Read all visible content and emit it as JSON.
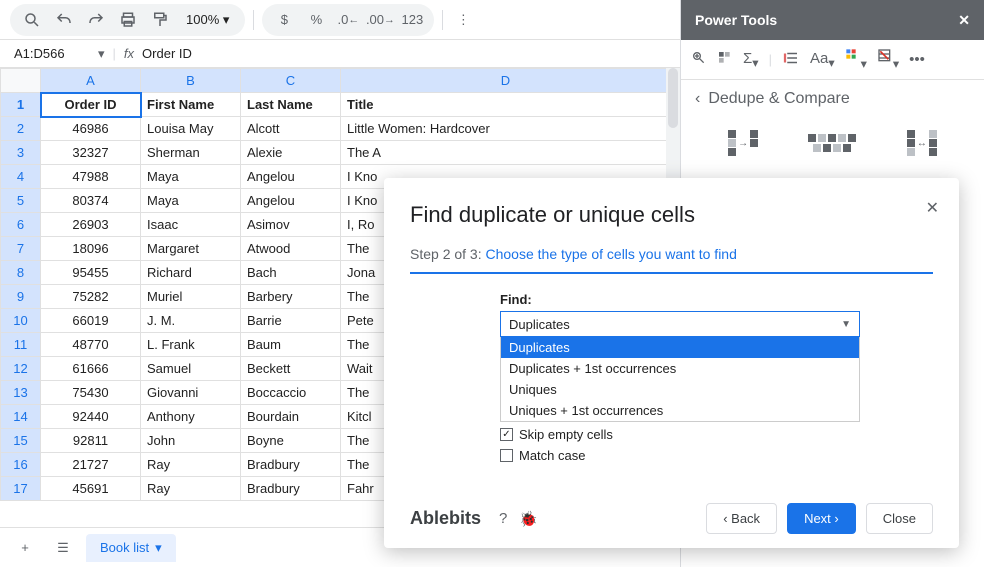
{
  "toolbar": {
    "zoom": "100%",
    "numfmt": "123"
  },
  "namebox": "A1:D566",
  "formula": "Order ID",
  "cols": [
    "A",
    "B",
    "C",
    "D"
  ],
  "headers": {
    "a": "Order ID",
    "b": "First Name",
    "c": "Last Name",
    "d": "Title"
  },
  "rows": [
    {
      "n": "2",
      "a": "46986",
      "b": "Louisa May",
      "c": "Alcott",
      "d": "Little Women: Hardcover"
    },
    {
      "n": "3",
      "a": "32327",
      "b": "Sherman",
      "c": "Alexie",
      "d": "The A"
    },
    {
      "n": "4",
      "a": "47988",
      "b": "Maya",
      "c": "Angelou",
      "d": "I Kno"
    },
    {
      "n": "5",
      "a": "80374",
      "b": "Maya",
      "c": "Angelou",
      "d": "I Kno"
    },
    {
      "n": "6",
      "a": "26903",
      "b": "Isaac",
      "c": "Asimov",
      "d": "I, Ro"
    },
    {
      "n": "7",
      "a": "18096",
      "b": "Margaret",
      "c": "Atwood",
      "d": "The"
    },
    {
      "n": "8",
      "a": "95455",
      "b": "Richard",
      "c": "Bach",
      "d": "Jona"
    },
    {
      "n": "9",
      "a": "75282",
      "b": "Muriel",
      "c": "Barbery",
      "d": "The"
    },
    {
      "n": "10",
      "a": "66019",
      "b": "J. M.",
      "c": "Barrie",
      "d": "Pete"
    },
    {
      "n": "11",
      "a": "48770",
      "b": "L. Frank",
      "c": "Baum",
      "d": "The"
    },
    {
      "n": "12",
      "a": "61666",
      "b": "Samuel",
      "c": "Beckett",
      "d": "Wait"
    },
    {
      "n": "13",
      "a": "75430",
      "b": "Giovanni",
      "c": "Boccaccio",
      "d": "The"
    },
    {
      "n": "14",
      "a": "92440",
      "b": "Anthony",
      "c": "Bourdain",
      "d": "Kitcl"
    },
    {
      "n": "15",
      "a": "92811",
      "b": "John",
      "c": "Boyne",
      "d": "The"
    },
    {
      "n": "16",
      "a": "21727",
      "b": "Ray",
      "c": "Bradbury",
      "d": "The"
    },
    {
      "n": "17",
      "a": "45691",
      "b": "Ray",
      "c": "Bradbury",
      "d": "Fahr"
    }
  ],
  "tab": {
    "name": "Book list"
  },
  "sidebar": {
    "title": "Power Tools",
    "section": "Dedupe & Compare"
  },
  "dialog": {
    "title": "Find duplicate or unique cells",
    "step_prefix": "Step 2 of 3: ",
    "step_link": "Choose the type of cells you want to find",
    "find_label": "Find:",
    "selected": "Duplicates",
    "options": [
      "Duplicates",
      "Duplicates + 1st occurrences",
      "Uniques",
      "Uniques + 1st occurrences"
    ],
    "skip_empty": "Skip empty cells",
    "match_case": "Match case",
    "brand": "Ablebits",
    "back": "Back",
    "next": "Next",
    "close": "Close"
  }
}
